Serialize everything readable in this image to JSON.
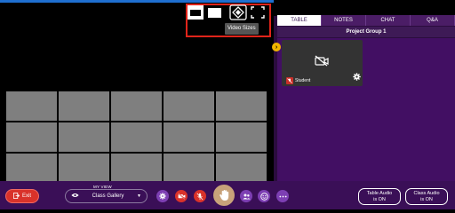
{
  "video_sizes": {
    "tooltip": "Video Sizes",
    "options": [
      "small-video-size-icon",
      "large-video-size-icon",
      "diamond-grid-icon",
      "fullscreen-icon"
    ]
  },
  "gallery": {
    "tile_count": 15
  },
  "sidebar": {
    "tabs": [
      {
        "label": "TABLE",
        "active": true
      },
      {
        "label": "NOTES",
        "active": false
      },
      {
        "label": "CHAT",
        "active": false
      },
      {
        "label": "Q&A",
        "active": false
      }
    ],
    "group_name": "Project Group 1",
    "participants": [
      {
        "name": "Student",
        "camera": "off",
        "mic": "off"
      }
    ]
  },
  "toolbar": {
    "exit_label": "Exit",
    "myview_label": "MY VIEW",
    "view_value": "Class Gallery",
    "table_audio_line1": "Table Audio",
    "table_audio_line2": "is ON",
    "class_audio_line1": "Class Audio",
    "class_audio_line2": "is ON"
  },
  "colors": {
    "accent_purple": "#7d3fb3",
    "danger_red": "#d9322a",
    "panel_bg": "#420f63",
    "toolbar_bg": "#3a0f57",
    "highlight_yellow": "#f1b400"
  }
}
